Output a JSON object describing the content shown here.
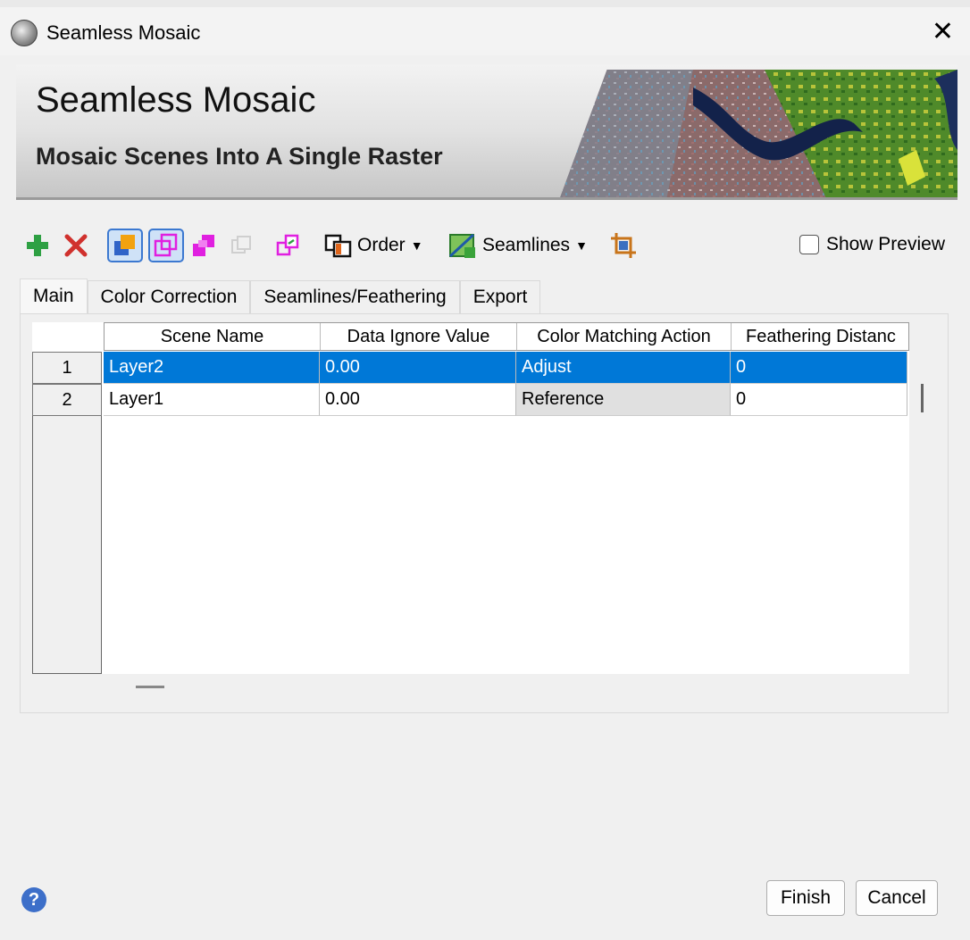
{
  "window": {
    "title": "Seamless Mosaic",
    "close_glyph": "✕"
  },
  "banner": {
    "title": "Seamless Mosaic",
    "subtitle": "Mosaic Scenes Into A Single Raster"
  },
  "toolbar": {
    "order_label": "Order",
    "seamlines_label": "Seamlines",
    "show_preview_label": "Show Preview",
    "show_preview_checked": false,
    "icons": [
      "add-icon",
      "remove-icon",
      "mosaic-footprint-icon",
      "boundary-icon",
      "overlap-icon",
      "disabled-copy-icon",
      "reproject-icon",
      "order-icon",
      "seamlines-icon",
      "crop-icon"
    ]
  },
  "tabs": [
    {
      "label": "Main",
      "active": true
    },
    {
      "label": "Color Correction",
      "active": false
    },
    {
      "label": "Seamlines/Feathering",
      "active": false
    },
    {
      "label": "Export",
      "active": false
    }
  ],
  "table": {
    "columns": [
      "Scene Name",
      "Data Ignore Value",
      "Color Matching Action",
      "Feathering Distanc"
    ],
    "rows": [
      {
        "num": "1",
        "scene": "Layer2",
        "ignore": "0.00",
        "action": "Adjust",
        "feather": "0",
        "selected": true
      },
      {
        "num": "2",
        "scene": "Layer1",
        "ignore": "0.00",
        "action": "Reference",
        "feather": "0",
        "selected": false
      }
    ]
  },
  "footer": {
    "help_glyph": "?",
    "finish_label": "Finish",
    "cancel_label": "Cancel"
  },
  "colors": {
    "selection": "#0078d7",
    "add_icon": "#2ea043",
    "remove_icon": "#d0312d",
    "magenta_icon": "#e020e0"
  }
}
